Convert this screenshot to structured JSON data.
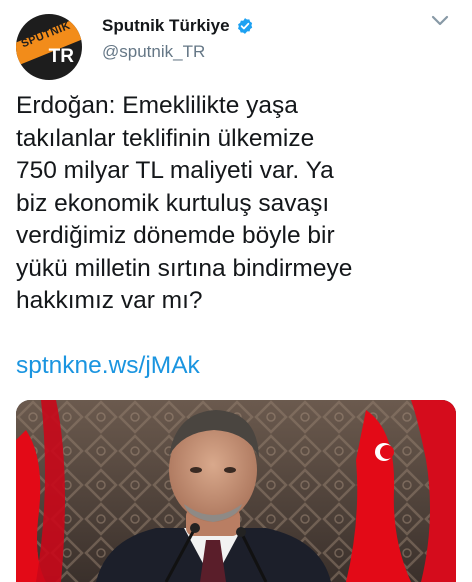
{
  "account": {
    "display_name": "Sputnik Türkiye",
    "handle": "@sputnik_TR",
    "avatar_brand": "SPUTNIK",
    "avatar_country": "TR"
  },
  "tweet": {
    "lines": [
      "Erdoğan: Emeklilikte yaşa",
      "takılanlar teklifinin ülkemize",
      "750 milyar TL maliyeti var. Ya",
      "biz ekonomik kurtuluş savaşı",
      "verdiğimiz dönemde böyle bir",
      "yükü milletin sırtına bindirmeye",
      "hakkımız var mı?"
    ],
    "link": "sptnkne.ws/jMAk"
  },
  "icons": {
    "verified": "verified-badge-icon",
    "more": "chevron-down-icon"
  },
  "colors": {
    "link": "#1b95e0",
    "verified": "#1da1f2",
    "handle": "#657786",
    "brand_orange": "#f28c1a",
    "flag_red": "#e30a17"
  }
}
